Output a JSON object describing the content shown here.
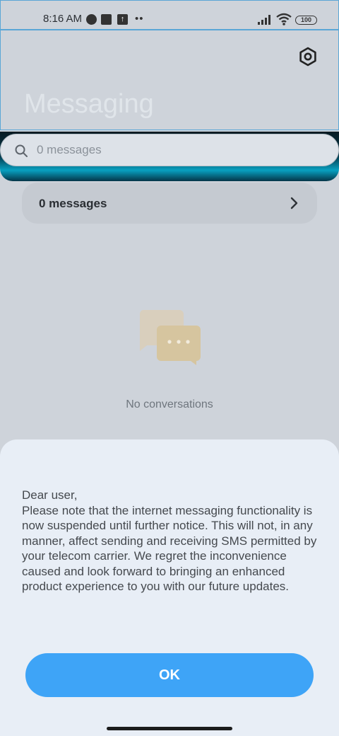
{
  "status_bar": {
    "time": "8:16 AM",
    "battery": "100",
    "icons": [
      "data-saver-icon",
      "notification-square-icon",
      "upload-icon",
      "more-notifications-icon",
      "signal-icon",
      "wifi-icon",
      "battery-icon"
    ]
  },
  "header": {
    "title": "Messaging",
    "settings_icon": "gear-icon"
  },
  "search": {
    "placeholder": "0 messages",
    "icon": "search-icon"
  },
  "messages_card": {
    "label": "0 messages",
    "icon": "chevron-right-icon"
  },
  "empty_state": {
    "icon": "chat-bubbles-icon",
    "text": "No conversations"
  },
  "dialog": {
    "message": "Dear user,\nPlease note that the internet messaging functionality is now suspended until further notice. This will not, in any manner, affect sending and receiving SMS permitted by your telecom carrier. We regret the inconvenience caused and look forward to bringing an enhanced product experience to you with our future updates.",
    "ok_label": "OK"
  },
  "colors": {
    "accent": "#3ea4f7",
    "dialog_bg": "#e8eef6",
    "backdrop": "#ced3da",
    "search_band": "#08a0c0"
  }
}
